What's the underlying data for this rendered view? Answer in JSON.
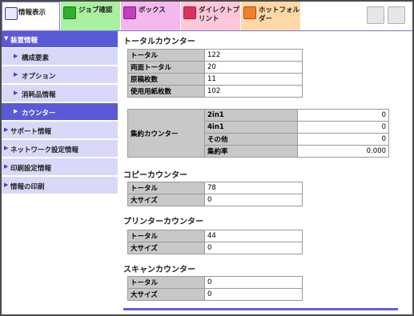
{
  "tabs": {
    "info": "情報表示",
    "job": "ジョブ確認",
    "box": "ボックス",
    "direct_print_line1": "ダイレクトプ",
    "direct_print_line2": "リント",
    "hot_folder_line1": "ホットフォル",
    "hot_folder_line2": "ダー"
  },
  "sidebar": {
    "device_info": "装置情報",
    "items": [
      {
        "label": "構成要素"
      },
      {
        "label": "オプション"
      },
      {
        "label": "消耗品情報"
      },
      {
        "label": "カウンター"
      }
    ],
    "support": "サポート情報",
    "network": "ネットワーク設定情報",
    "print_settings": "印刷設定情報",
    "print_info": "情報の印刷"
  },
  "total_counter": {
    "title": "トータルカウンター",
    "rows": [
      {
        "key": "トータル",
        "value": "122"
      },
      {
        "key": "両面トータル",
        "value": "20"
      },
      {
        "key": "原稿枚数",
        "value": "11"
      },
      {
        "key": "使用用紙枚数",
        "value": "102"
      }
    ]
  },
  "aggregate_counter": {
    "title": "集約カウンター",
    "rows": [
      {
        "key": "2in1",
        "value": "0"
      },
      {
        "key": "4in1",
        "value": "0"
      },
      {
        "key": "その他",
        "value": "0"
      },
      {
        "key": "集約率",
        "value": "0.000"
      }
    ]
  },
  "copy_counter": {
    "title": "コピーカウンター",
    "rows": [
      {
        "key": "トータル",
        "value": "78"
      },
      {
        "key": "大サイズ",
        "value": "0"
      }
    ]
  },
  "printer_counter": {
    "title": "プリンターカウンター",
    "rows": [
      {
        "key": "トータル",
        "value": "44"
      },
      {
        "key": "大サイズ",
        "value": "0"
      }
    ]
  },
  "scan_counter": {
    "title": "スキャンカウンター",
    "rows": [
      {
        "key": "トータル",
        "value": "0"
      },
      {
        "key": "大サイズ",
        "value": "0"
      }
    ]
  },
  "icons": {
    "info": "monitor-icon",
    "job": "job-icon",
    "box": "box-icon",
    "direct_print": "printer-icon",
    "hot_folder": "folder-icon",
    "refresh": "refresh-icon",
    "window": "window-icon"
  },
  "colors": {
    "accent": "#5a5ad8",
    "sidebar_bg": "#d8d8f8",
    "job_tab": "#a8f0a0",
    "box_tab": "#f4b8ee",
    "direct_tab": "#ffc8d8",
    "hot_tab": "#ffd8a8"
  }
}
